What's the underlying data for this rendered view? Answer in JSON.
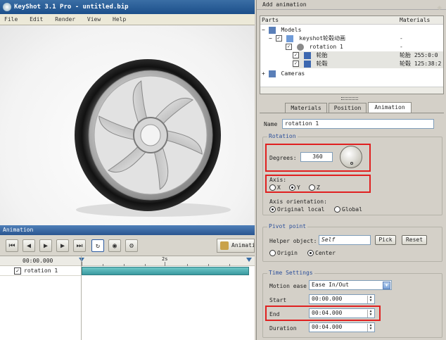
{
  "window": {
    "title": "KeyShot 3.1 Pro  - untitled.bip"
  },
  "menu": [
    "File",
    "Edit",
    "Render",
    "View",
    "Help"
  ],
  "animation_panel": {
    "header": "Animation",
    "animation_button": "Animation",
    "timeline_start": "00:00.000",
    "ruler_mark": "2s",
    "track_label": "rotation 1"
  },
  "right_panel": {
    "header": "Add animation",
    "tree": {
      "col_parts": "Parts",
      "col_materials": "Materials",
      "rows": [
        {
          "label": "Models",
          "material": ""
        },
        {
          "label": "keyshot轮毂动画",
          "material": "-"
        },
        {
          "label": "rotation 1",
          "material": "-"
        },
        {
          "label": "轮胎",
          "material": "轮胎 255:0:0"
        },
        {
          "label": "轮毂",
          "material": "轮毂 125:38:2"
        },
        {
          "label": "Cameras",
          "material": ""
        }
      ]
    },
    "tabs": [
      "Materials",
      "Position",
      "Animation"
    ],
    "name_label": "Name",
    "name_value": "rotation 1",
    "rotation": {
      "group_label": "Rotation",
      "degrees_label": "Degrees:",
      "degrees_value": "360",
      "axis_label": "Axis:",
      "axes": [
        "X",
        "Y",
        "Z"
      ],
      "axis_selected": "Y",
      "orientation_label": "Axis orientation:",
      "orientation_options": [
        "Original local",
        "Global"
      ],
      "orientation_selected": "Original local"
    },
    "pivot": {
      "group_label": "Pivot point",
      "helper_label": "Helper object:",
      "helper_value": "Self",
      "pick_button": "Pick",
      "reset_button": "Reset",
      "options": [
        "Origin",
        "Center"
      ],
      "selected": "Center"
    },
    "time": {
      "group_label": "Time Settings",
      "motion_ease_label": "Motion ease",
      "motion_ease_value": "Ease In/Out",
      "start_label": "Start",
      "start_value": "00:00.000",
      "end_label": "End",
      "end_value": "00:04.000",
      "duration_label": "Duration",
      "duration_value": "00:04.000"
    }
  },
  "accent_colors": {
    "title_bar": "#1c4f8a",
    "highlight": "#e02020",
    "track": "#3a9aa0"
  }
}
